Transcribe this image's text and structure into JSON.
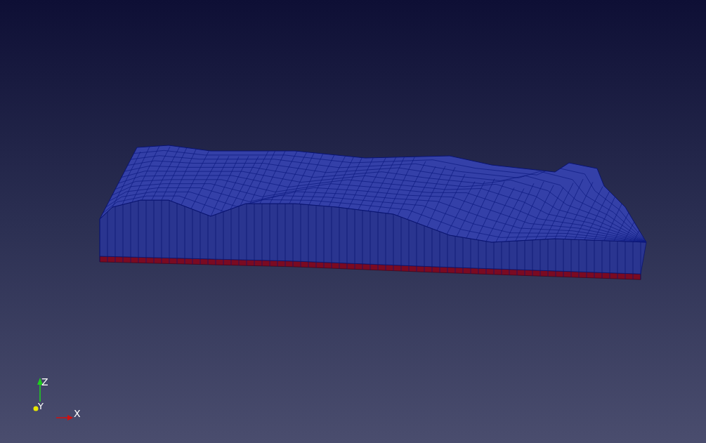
{
  "viewport": {
    "axes_triad": [
      {
        "kind": "z",
        "label": "Z",
        "color": "#1fd01f"
      },
      {
        "kind": "y",
        "label": "Y",
        "color": "#e8e800"
      },
      {
        "kind": "x",
        "label": "X",
        "color": "#d01010"
      }
    ]
  }
}
